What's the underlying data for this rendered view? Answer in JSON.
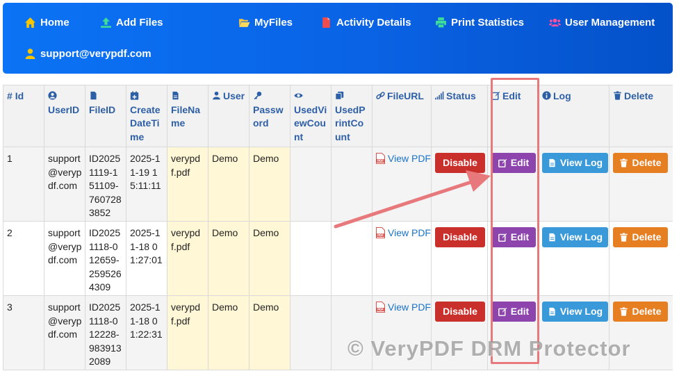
{
  "nav": {
    "home": "Home",
    "add_files": "Add Files",
    "my_files": "MyFiles",
    "activity_details": "Activity Details",
    "print_statistics": "Print Statistics",
    "user_management": "User Management",
    "account": "support@verypdf.com"
  },
  "headers": {
    "id": "Id",
    "user_id": "UserID",
    "file_id": "FileID",
    "create_date_time": "Create DateTime",
    "file_name": "FileName",
    "user": "User",
    "password": "Password",
    "used_view_count": "UsedViewCount",
    "used_print_count": "UsedPrintCount",
    "file_url": "FileURL",
    "status": "Status",
    "edit": "Edit",
    "log": "Log",
    "delete": "Delete"
  },
  "rows": [
    {
      "id": "1",
      "user_id": "support@verypdf.com",
      "file_id": "ID20251119-151109-7607283852",
      "create_date_time": "2025-11-19 15:11:11",
      "file_name": "verypdf.pdf",
      "user": "Demo",
      "password": "Demo",
      "used_view_count": "",
      "used_print_count": "",
      "file_url": "View PDF",
      "status_button": "Disable",
      "edit_button": "Edit",
      "log_button": "View Log",
      "delete_button": "Delete"
    },
    {
      "id": "2",
      "user_id": "support@verypdf.com",
      "file_id": "ID20251118-012659-2595264309",
      "create_date_time": "2025-11-18 01:27:01",
      "file_name": "verypdf.pdf",
      "user": "Demo",
      "password": "Demo",
      "used_view_count": "",
      "used_print_count": "",
      "file_url": "View PDF",
      "status_button": "Disable",
      "edit_button": "Edit",
      "log_button": "View Log",
      "delete_button": "Delete"
    },
    {
      "id": "3",
      "user_id": "support@verypdf.com",
      "file_id": "ID20251118-012228-9839132089",
      "create_date_time": "2025-11-18 01:22:31",
      "file_name": "verypdf.pdf",
      "user": "Demo",
      "password": "Demo",
      "used_view_count": "",
      "used_print_count": "",
      "file_url": "View PDF",
      "status_button": "Disable",
      "edit_button": "Edit",
      "log_button": "View Log",
      "delete_button": "Delete"
    }
  ],
  "watermark": "© VeryPDF DRM Protector",
  "colors": {
    "nav_background": "#0a62e4",
    "header_text": "#2d5fa6",
    "disable_button": "#c9302c",
    "edit_button": "#8e44ad",
    "log_button": "#3a9ad9",
    "delete_button": "#e67e22",
    "highlight_annotation": "#e7797c",
    "yellow_cells": "#fff7d6"
  }
}
